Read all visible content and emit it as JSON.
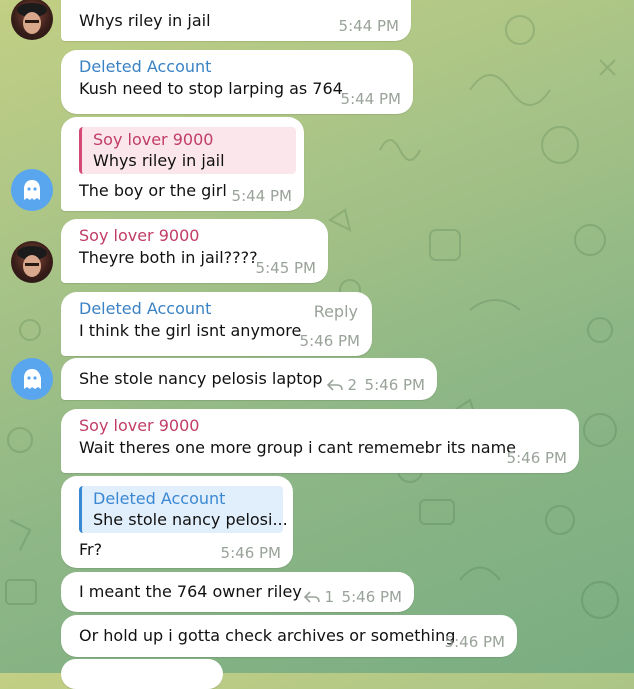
{
  "messages": [
    {
      "sender": "",
      "text": "Whys riley in jail",
      "time": "5:44 PM"
    },
    {
      "sender": "Deleted Account",
      "text": "Kush need to stop larping as 764",
      "time": "5:44 PM"
    },
    {
      "reply_to": {
        "name": "Soy lover 9000",
        "text": "Whys riley in jail"
      },
      "text": "The boy or the girl",
      "time": "5:44 PM"
    },
    {
      "sender": "Soy lover 9000",
      "text": "Theyre both in jail????",
      "time": "5:45 PM"
    },
    {
      "sender": "Deleted Account",
      "reply_label": "Reply",
      "text": "I think the girl isnt anymore",
      "time": "5:46 PM"
    },
    {
      "text": "She stole nancy pelosis laptop",
      "replies": "2",
      "time": "5:46 PM"
    },
    {
      "sender": "Soy lover 9000",
      "text": "Wait theres one more group i cant rememebr its name",
      "time": "5:46 PM"
    },
    {
      "reply_to": {
        "name": "Deleted Account",
        "text": "She stole nancy pelosi..."
      },
      "text": "Fr?",
      "time": "5:46 PM"
    },
    {
      "text": "I meant the 764 owner riley",
      "replies": "1",
      "time": "5:46 PM"
    },
    {
      "text": "Or hold up i gotta check archives or something",
      "time": "5:46 PM"
    }
  ],
  "colors": {
    "sender_blue": "#3b82c4",
    "sender_pink": "#c13d66",
    "avatar_ghost": "#5aa6ee"
  },
  "icons": {
    "reply_arrow": "reply-arrow-icon",
    "ghost": "ghost-icon"
  }
}
